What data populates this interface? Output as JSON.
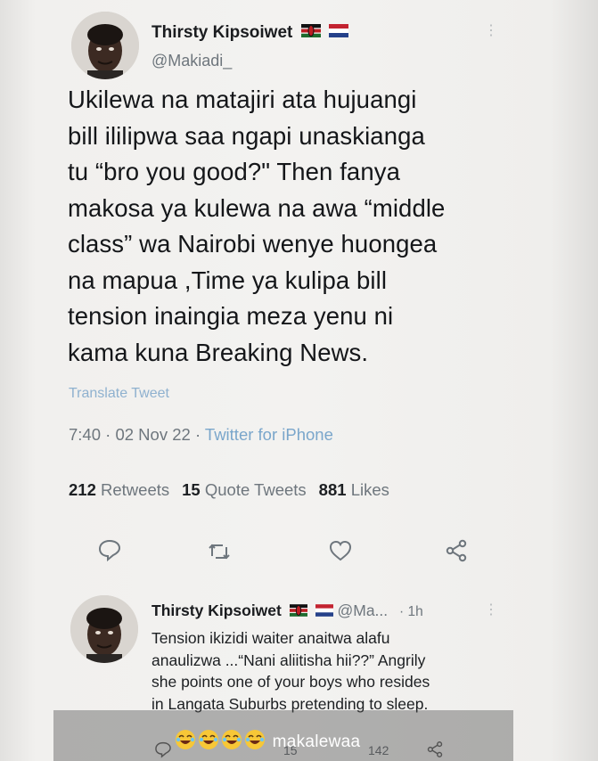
{
  "tweet": {
    "author_name": "Thirsty Kipsoiwet",
    "author_handle": "@Makiadi_",
    "flags": [
      "kenya-flag",
      "netherlands-flag"
    ],
    "text_lines": [
      "Ukilewa na matajiri ata hujuangi",
      "bill ililipwa saa ngapi unaskianga",
      "tu “bro you good?\" Then fanya",
      "makosa ya kulewa na awa “middle",
      "class” wa Nairobi wenye huongea",
      "na mapua ,Time ya kulipa bill",
      "tension inaingia meza yenu ni",
      "kama kuna Breaking News."
    ],
    "translate_label": "Translate Tweet",
    "time": "7:40",
    "separator": " · ",
    "date": "02 Nov 22",
    "source": "Twitter for iPhone",
    "retweets_count": "212",
    "retweets_label": "Retweets",
    "quotes_count": "15",
    "quotes_label": "Quote Tweets",
    "likes_count": "881",
    "likes_label": "Likes",
    "actions": [
      "reply-icon",
      "retweet-icon",
      "like-icon",
      "share-icon"
    ]
  },
  "reply": {
    "author_name": "Thirsty Kipsoiwet",
    "author_handle": "@Ma...",
    "time": "· 1h",
    "text_lines": [
      "Tension ikizidi waiter anaitwa alafu",
      "anaulizwa ...“Nani aliitisha hii??” Angrily",
      "she points one of your boys who resides",
      "in Langata Suburbs pretending to sleep."
    ],
    "retweets_count": "15",
    "likes_count": "142"
  },
  "caption": {
    "emoji": [
      "laughing-emoji",
      "laughing-emoji",
      "laughing-emoji",
      "laughing-emoji"
    ],
    "text": "makalewaa"
  },
  "colors": {
    "link": "#7aa6cb",
    "muted": "#6e767d",
    "text": "#141619"
  }
}
